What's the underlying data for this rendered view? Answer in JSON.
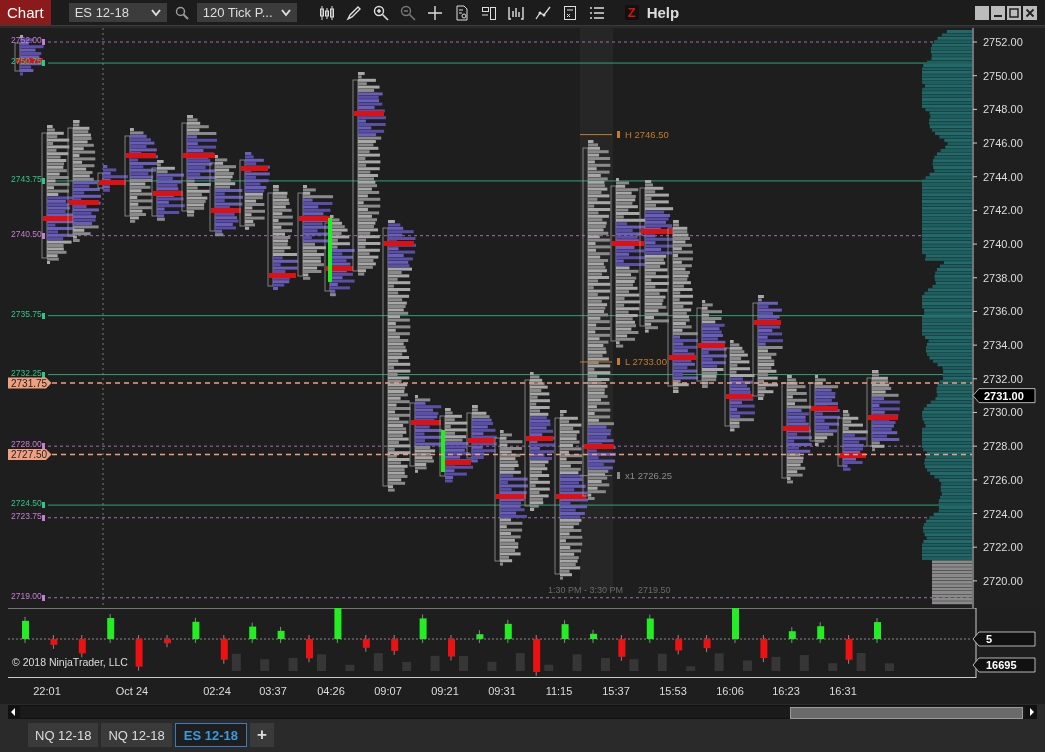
{
  "toolbar": {
    "title": "Chart",
    "instrument": "ES 12-18",
    "interval": "120 Tick P...",
    "z_label": "Z",
    "help": "Help"
  },
  "price_levels": [
    {
      "label": "2752.00",
      "color": "#c77dd6"
    },
    {
      "label": "2750.75",
      "color": "#2fc68a"
    },
    {
      "label": "2743.75",
      "color": "#2fc68a"
    },
    {
      "label": "2740.50",
      "color": "#c77dd6"
    },
    {
      "label": "2735.75",
      "color": "#2fc68a"
    },
    {
      "label": "2732.25",
      "color": "#2fc68a"
    },
    {
      "label": "2728.00",
      "color": "#c77dd6"
    },
    {
      "label": "2724.50",
      "color": "#2fc68a"
    },
    {
      "label": "2723.75",
      "color": "#c77dd6"
    },
    {
      "label": "2719.00",
      "color": "#c77dd6"
    }
  ],
  "markers": [
    {
      "label": "2731.75"
    },
    {
      "label": "2727.50"
    }
  ],
  "annotations": [
    {
      "label": "H 2746.50",
      "color": "#c87a2a"
    },
    {
      "label": "L 2733.00",
      "color": "#c87a2a"
    },
    {
      "label": "x1 2726.25",
      "color": "#8a8a8a"
    }
  ],
  "session": {
    "label": "1:30 PM - 3:30 PM",
    "low": "2719.50"
  },
  "axis_ticks": [
    "2752.00",
    "2750.00",
    "2748.00",
    "2746.00",
    "2744.00",
    "2742.00",
    "2740.00",
    "2738.00",
    "2736.00",
    "2734.00",
    "2732.00",
    "2730.00",
    "2728.00",
    "2726.00",
    "2724.00",
    "2722.00",
    "2720.00"
  ],
  "current_price": "2731.00",
  "volume_pane": {
    "copyright": "© 2018 NinjaTrader, LLC",
    "ticks_value": "5",
    "volume_value": "16695"
  },
  "time_axis": [
    "22:01",
    "Oct 24",
    "02:24",
    "03:37",
    "04:26",
    "09:07",
    "09:21",
    "09:31",
    "11:15",
    "15:37",
    "15:53",
    "16:06",
    "16:23",
    "16:31"
  ],
  "tabs": [
    {
      "label": "NQ 12-18",
      "selected": false
    },
    {
      "label": "NQ 12-18",
      "selected": false
    },
    {
      "label": "ES 12-18",
      "selected": true
    }
  ],
  "add_tab": "+"
}
